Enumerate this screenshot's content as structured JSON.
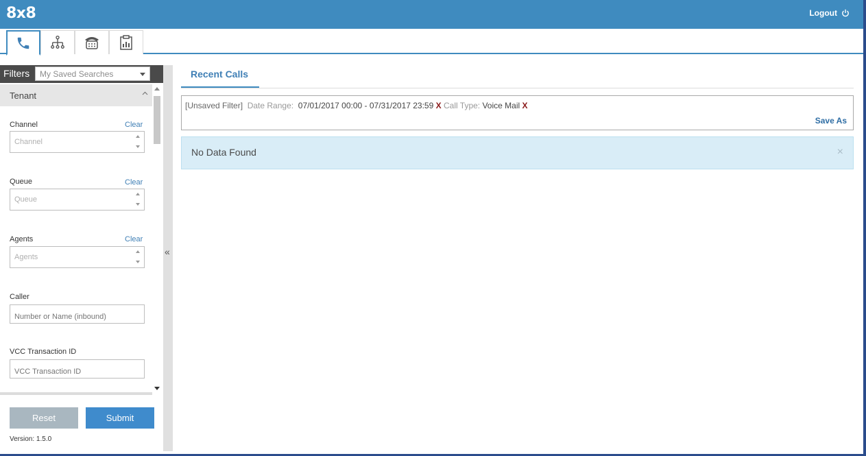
{
  "app": {
    "logo_text": "8x8",
    "logout_label": "Logout"
  },
  "top_tabs": [
    {
      "icon": "phone-icon",
      "active": true
    },
    {
      "icon": "org-chart-icon",
      "active": false
    },
    {
      "icon": "contact-center-icon",
      "active": false
    },
    {
      "icon": "report-clipboard-icon",
      "active": false
    }
  ],
  "sidebar": {
    "title": "Filters",
    "saved_searches_placeholder": "My Saved Searches",
    "section_title": "Tenant",
    "clear_label": "Clear",
    "fields": {
      "channel": {
        "label": "Channel",
        "placeholder": "Channel"
      },
      "queue": {
        "label": "Queue",
        "placeholder": "Queue"
      },
      "agents": {
        "label": "Agents",
        "placeholder": "Agents"
      },
      "caller": {
        "label": "Caller",
        "placeholder": "Number or Name (inbound)"
      },
      "vcc": {
        "label": "VCC Transaction ID",
        "placeholder": "VCC Transaction ID"
      }
    },
    "reset_label": "Reset",
    "submit_label": "Submit",
    "version_text": "Version: 1.5.0",
    "collapse_glyph": "«"
  },
  "main": {
    "tab_label": "Recent Calls",
    "filter": {
      "unsaved": "[Unsaved Filter]",
      "date_label": "Date Range:",
      "date_value": "07/01/2017 00:00 - 07/31/2017 23:59",
      "type_label": "Call Type:",
      "type_value": "Voice Mail",
      "remove_glyph": "X",
      "save_as": "Save As"
    },
    "alert": {
      "text": "No Data Found",
      "close_glyph": "×"
    }
  },
  "colors": {
    "brand": "#3f8bbf",
    "accent_link": "#3f7fb5",
    "remove": "#8b1a1a",
    "alert_bg": "#d9edf7"
  }
}
